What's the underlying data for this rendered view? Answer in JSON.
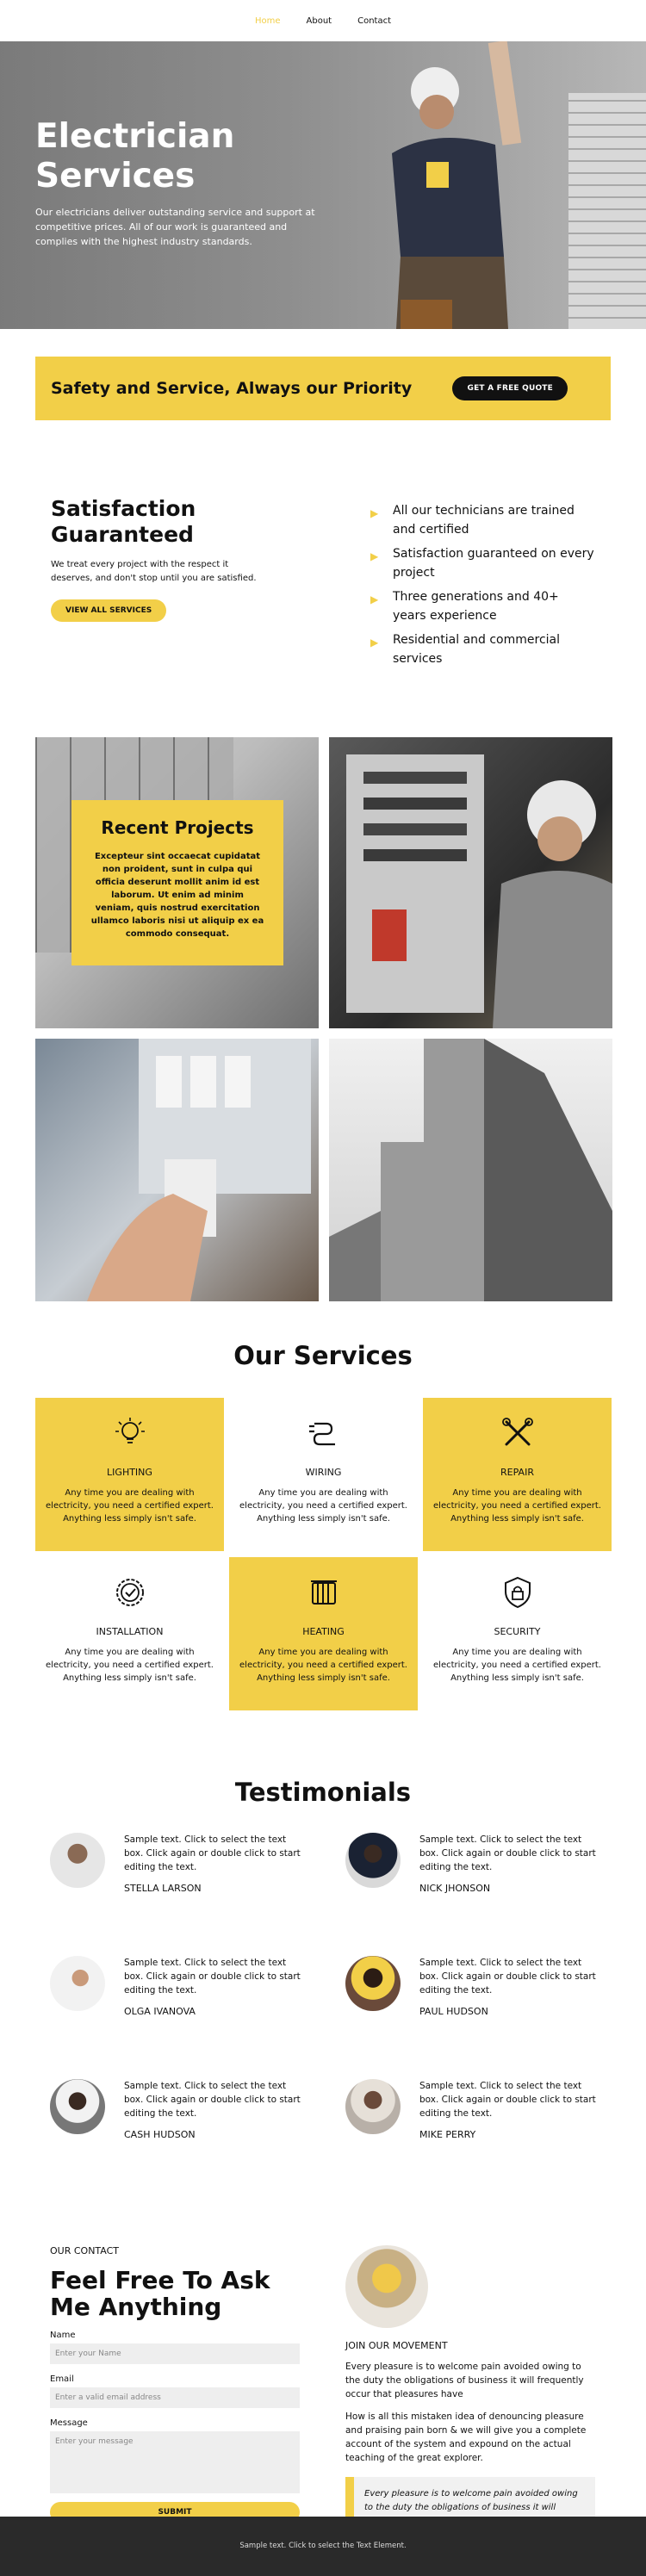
{
  "nav": {
    "items": [
      "Home",
      "About",
      "Contact"
    ],
    "active": "Home"
  },
  "hero": {
    "title": "Electrician Services",
    "description": "Our electricians deliver outstanding service and support at competitive prices. All of our work is guaranteed and complies with the highest industry standards."
  },
  "banner": {
    "title": "Safety and Service, Always our Priority",
    "button": "GET A FREE QUOTE"
  },
  "satisfaction": {
    "title": "Satisfaction Guaranteed",
    "text": "We treat every project with the respect it deserves, and don't stop until you are satisfied.",
    "button": "VIEW ALL SERVICES",
    "points": [
      "All our technicians are trained and certified",
      "Satisfaction guaranteed on every project",
      "Three generations and 40+ years experience",
      "Residential and commercial services"
    ]
  },
  "projects": {
    "title": "Recent Projects",
    "text": "Excepteur sint occaecat cupidatat non proident, sunt in culpa qui officia deserunt mollit anim id est laborum. Ut enim ad minim veniam, quis nostrud exercitation ullamco laboris nisi ut aliquip ex ea commodo consequat."
  },
  "services": {
    "title": "Our Services",
    "items": [
      {
        "name": "LIGHTING",
        "icon": "lightbulb-icon",
        "text": "Any time you are dealing with electricity, you need a certified expert. Anything less simply isn't safe.",
        "highlight": true
      },
      {
        "name": "WIRING",
        "icon": "plug-icon",
        "text": "Any time you are dealing with electricity, you need a certified expert. Anything less simply isn't safe.",
        "highlight": false
      },
      {
        "name": "REPAIR",
        "icon": "tools-icon",
        "text": "Any time you are dealing with electricity, you need a certified expert. Anything less simply isn't safe.",
        "highlight": true
      },
      {
        "name": "INSTALLATION",
        "icon": "badge-check-icon",
        "text": "Any time you are dealing with electricity, you need a certified expert. Anything less simply isn't safe.",
        "highlight": false
      },
      {
        "name": "HEATING",
        "icon": "radiator-icon",
        "text": "Any time you are dealing with electricity, you need a certified expert. Anything less simply isn't safe.",
        "highlight": true
      },
      {
        "name": "SECURITY",
        "icon": "shield-lock-icon",
        "text": "Any time you are dealing with electricity, you need a certified expert. Anything less simply isn't safe.",
        "highlight": false
      }
    ]
  },
  "testimonials": {
    "title": "Testimonials",
    "items": [
      {
        "name": "STELLA LARSON",
        "text": "Sample text. Click to select the text box. Click again or double click to start editing the text."
      },
      {
        "name": "NICK JHONSON",
        "text": "Sample text. Click to select the text box. Click again or double click to start editing the text."
      },
      {
        "name": "OLGA IVANOVA",
        "text": "Sample text. Click to select the text box. Click again or double click to start editing the text."
      },
      {
        "name": "PAUL HUDSON",
        "text": "Sample text. Click to select the text box. Click again or double click to start editing the text."
      },
      {
        "name": "CASH HUDSON",
        "text": "Sample text. Click to select the text box. Click again or double click to start editing the text."
      },
      {
        "name": "MIKE PERRY",
        "text": "Sample text. Click to select the text box. Click again or double click to start editing the text."
      }
    ]
  },
  "contact": {
    "eyebrow": "OUR CONTACT",
    "title": "Feel Free To Ask Me Anything",
    "name_label": "Name",
    "name_placeholder": "Enter your Name",
    "email_label": "Email",
    "email_placeholder": "Enter a valid email address",
    "message_label": "Message",
    "message_placeholder": "Enter your message",
    "submit": "SUBMIT",
    "side_title": "JOIN OUR MOVEMENT",
    "para1": "Every pleasure is to welcome pain avoided owing to the duty the obligations of business it will frequently occur that pleasures have",
    "para2": "How is all this mistaken idea of denouncing pleasure and praising pain born & we will give you a complete account of the system and expound on the actual teaching of the great explorer.",
    "quote": "Every pleasure is to welcome pain avoided owing to the duty the obligations of business it will frequently occur"
  },
  "footer": {
    "text": "Sample text. Click to select the Text Element."
  },
  "colors": {
    "accent": "#f2cf48",
    "dark": "#111111",
    "footer": "#2a2a2a"
  }
}
